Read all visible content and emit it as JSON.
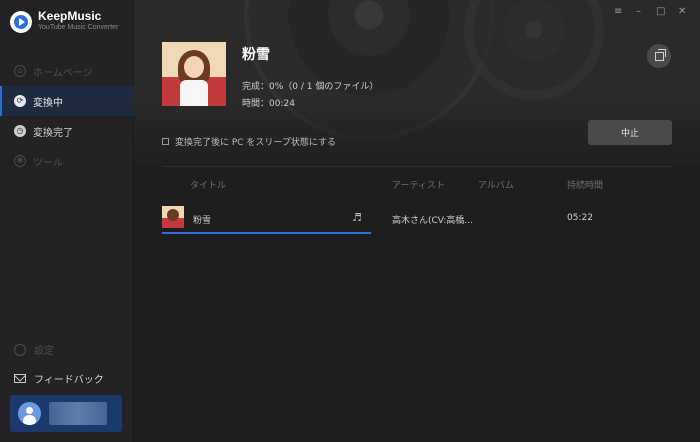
{
  "app": {
    "name": "KeepMusic",
    "subtitle": "YouTube Music Converter"
  },
  "sidebar": {
    "items": [
      {
        "label": "ホームページ",
        "icon": "home-icon",
        "state": "disabled"
      },
      {
        "label": "変換中",
        "icon": "converting-icon",
        "state": "active"
      },
      {
        "label": "変換完了",
        "icon": "clock-icon",
        "state": "normal"
      },
      {
        "label": "ツール",
        "icon": "tools-icon",
        "state": "disabled"
      }
    ],
    "settings_label": "設定",
    "feedback_label": "フィードバック"
  },
  "window_controls": [
    "≡",
    "–",
    "□",
    "✕"
  ],
  "hero": {
    "title": "粉雪",
    "progress_text": "完成：0%（0 / 1 個のファイル）",
    "time_text": "時間：00:24",
    "sleep_label": "変換完了後に PC をスリープ状態にする",
    "sleep_checked": false,
    "stop_label": "中止"
  },
  "table": {
    "headers": [
      "タイトル",
      "アーティスト",
      "アルバム",
      "持続時間"
    ],
    "rows": [
      {
        "title": "粉雪",
        "artist": "高木さん(CV:高橋...",
        "album": "",
        "duration": "05:22",
        "progress": 0.41
      }
    ]
  },
  "colors": {
    "accent": "#2d6fd8",
    "sidebar": "#232325",
    "background": "#1e1e20"
  }
}
